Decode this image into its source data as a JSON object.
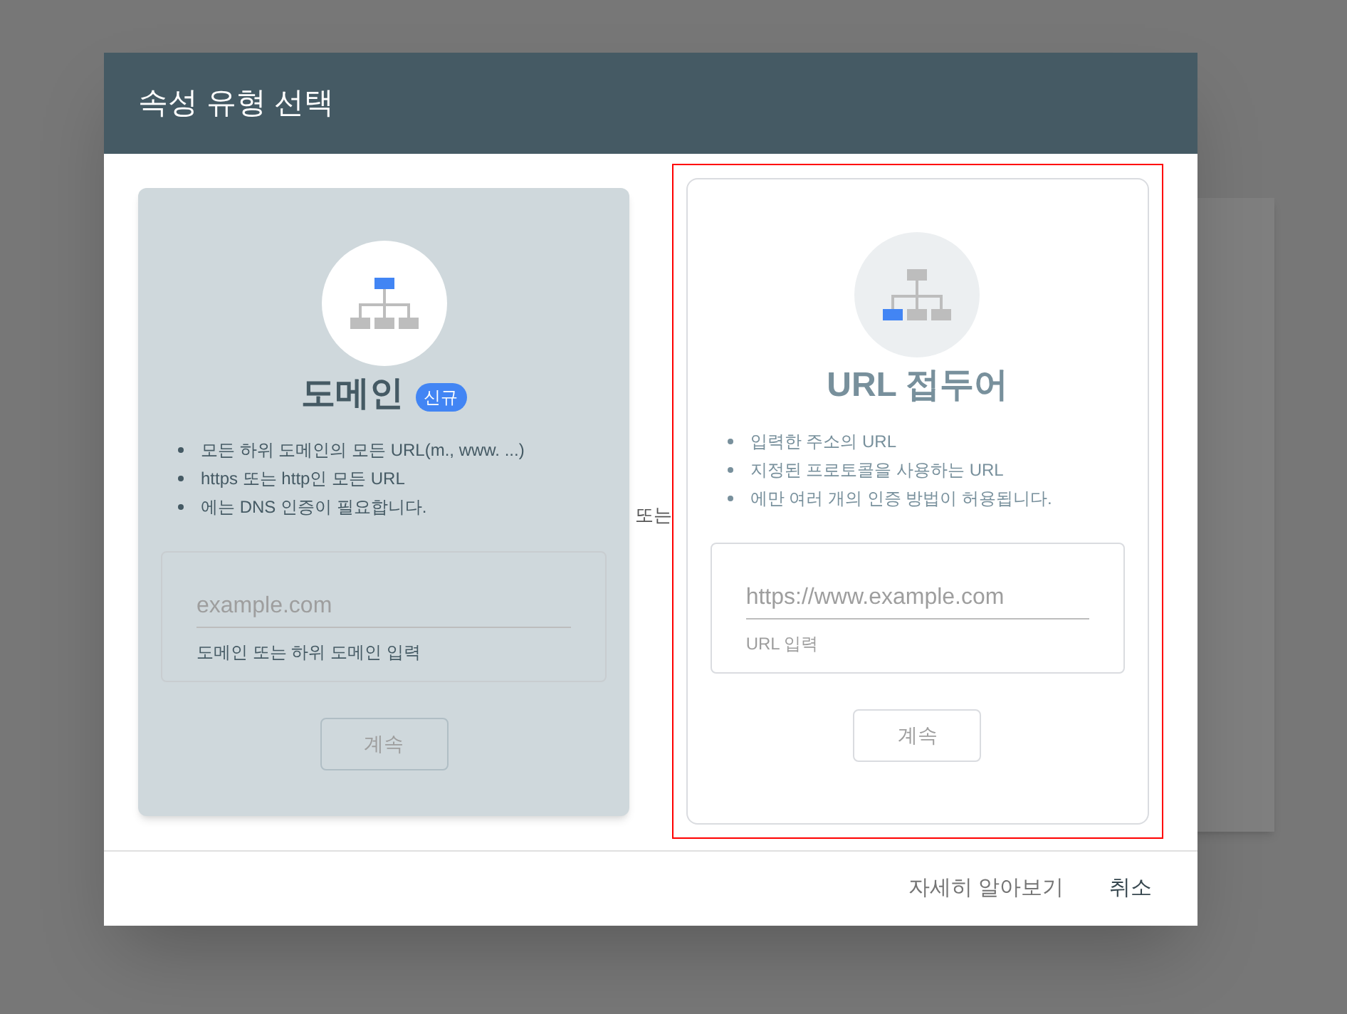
{
  "dialog": {
    "title": "속성 유형 선택",
    "separator": "또는",
    "cards": [
      {
        "kind": "domain",
        "title": "도메인",
        "badge": "신규",
        "selected": true,
        "highlighted": false,
        "bullets": [
          "모든 하위 도메인의 모든 URL(m., www. ...)",
          "https 또는 http인 모든 URL",
          "에는 DNS 인증이 필요합니다."
        ],
        "field": {
          "placeholder": "example.com",
          "helper": "도메인 또는 하위 도메인 입력"
        },
        "button": "계속"
      },
      {
        "kind": "prefix",
        "title": "URL 접두어",
        "selected": false,
        "highlighted": true,
        "bullets": [
          "입력한 주소의 URL",
          "지정된 프로토콜을 사용하는 URL",
          "에만 여러 개의 인증 방법이 허용됩니다."
        ],
        "field": {
          "placeholder": "https://www.example.com",
          "helper": "URL 입력"
        },
        "button": "계속"
      }
    ],
    "footer": {
      "buttons": [
        "자세히 알아보기",
        "취소"
      ]
    }
  }
}
